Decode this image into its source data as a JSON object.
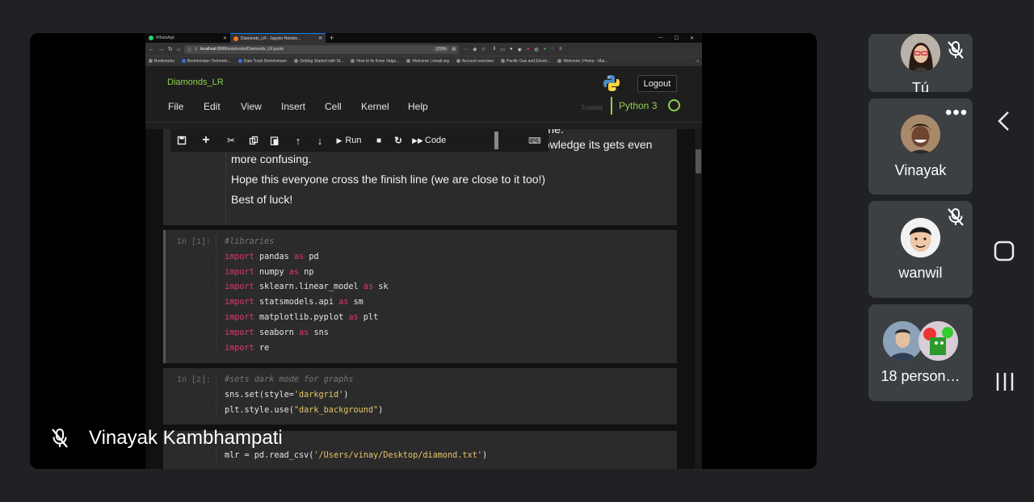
{
  "browser": {
    "tabs": [
      {
        "title": "WhatsApp"
      },
      {
        "title": "Diamonds_LR - Jupyter Notebo..."
      }
    ],
    "url_prefix": "localhost",
    "url_rest": ":8888/notebooks/Diamonds_LR.ipynb",
    "zoom": "170%",
    "bookmarks": [
      "Bookmarks",
      "Bertelsmann Technolo...",
      "Data Track Bertelsmann",
      "Getting Started with St...",
      "How to fix Knee Valgu...",
      "Welcome | email.org",
      "Account overview",
      "Pacific Gas and Electri...",
      "Welcome | Home - Mai..."
    ]
  },
  "jupyter": {
    "notebook_title": "Diamonds_LR",
    "logout_label": "Logout",
    "menu": [
      "File",
      "Edit",
      "View",
      "Insert",
      "Cell",
      "Kernel",
      "Help"
    ],
    "trusted_label": "Trusted",
    "kernel_name": "Python 3",
    "toolbar": {
      "run_label": "Run",
      "cell_type": "Code"
    },
    "markdown": {
      "line_partial": "notebook to help understand the code and what needs to be done.",
      "line1": "Coding is tough to begin with but when you add in business knowledge its gets even more confusing.",
      "line2": "Hope this everyone cross the finish line (we are close to it too!)",
      "line3": "Best of luck!"
    },
    "cells": [
      {
        "prompt": "In [1]:",
        "comment": "#libraries",
        "imports": [
          {
            "kw": "import",
            "mod": "pandas",
            "as": "as",
            "alias": "pd"
          },
          {
            "kw": "import",
            "mod": "numpy",
            "as": "as",
            "alias": "np"
          },
          {
            "kw": "import",
            "mod": "sklearn.linear_model",
            "as": "as",
            "alias": "sk"
          },
          {
            "kw": "import",
            "mod": "statsmodels.api",
            "as": "as",
            "alias": "sm"
          },
          {
            "kw": "import",
            "mod": "matplotlib.pyplot",
            "as": "as",
            "alias": "plt"
          },
          {
            "kw": "import",
            "mod": "seaborn",
            "as": "as",
            "alias": "sns"
          },
          {
            "kw": "import",
            "mod": "re",
            "as": "",
            "alias": ""
          }
        ]
      },
      {
        "prompt": "In [2]:",
        "comment": "#sets dark mode for graphs",
        "line1_a": "sns.set(style=",
        "line1_str": "'darkgrid'",
        "line1_b": ")",
        "line2_a": "plt.style.use(",
        "line2_str": "\"dark_background\"",
        "line2_b": ")"
      },
      {
        "line_a": "mlr = pd.read_csv(",
        "line_str": "'/Users/vinay/Desktop/diamond.txt'",
        "line_b": ")"
      }
    ]
  },
  "meeting": {
    "presenter_name": "Vinayak Kambhampati",
    "participants": [
      {
        "name": "Tú",
        "muted": true
      },
      {
        "name": "Vinayak",
        "muted": false
      },
      {
        "name": "wanwil",
        "muted": true
      },
      {
        "name": "18 person…",
        "muted": false
      }
    ]
  },
  "colors": {
    "jupyter_green": "#8fd14f",
    "keyword_pink": "#e8336b",
    "string_yellow": "#e8c56b",
    "tile_bg": "#3c4043"
  }
}
